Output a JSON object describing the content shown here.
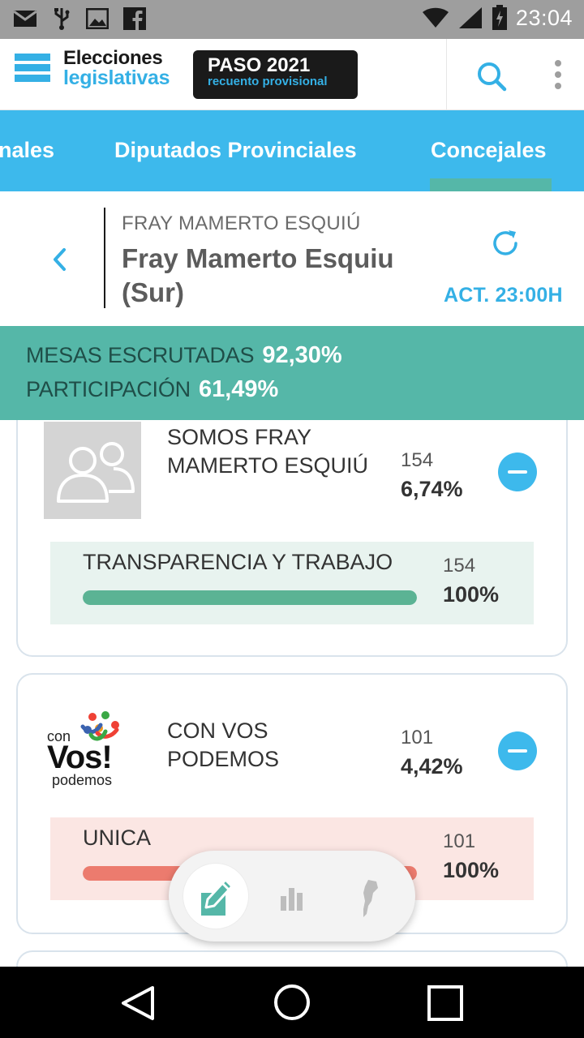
{
  "status_bar": {
    "time": "23:04",
    "left_icons": [
      "mail-icon",
      "usb-icon",
      "image-icon",
      "facebook-icon"
    ],
    "right_icons": [
      "wifi-icon",
      "signal-icon",
      "battery-icon"
    ]
  },
  "header": {
    "logo_line1": "Elecciones",
    "logo_line2": "legislativas",
    "badge_title": "PASO 2021",
    "badge_subtitle": "recuento provisional",
    "brand_color": "#34b0e5"
  },
  "tabs": [
    {
      "label": "nales",
      "active": false
    },
    {
      "label": "Diputados Provinciales",
      "active": false
    },
    {
      "label": "Concejales",
      "active": true
    }
  ],
  "location": {
    "region": "FRAY MAMERTO ESQUIÚ",
    "title": "Fray Mamerto Esquiu (Sur)",
    "updated": "ACT. 23:00H"
  },
  "stats": {
    "mesas_label": "MESAS ESCRUTADAS",
    "mesas_value": "92,30%",
    "participacion_label": "PARTICIPACIÓN",
    "participacion_value": "61,49%"
  },
  "parties": [
    {
      "name": "SOMOS FRAY MAMERTO ESQUIÚ",
      "votes": "154",
      "percent": "6,74%",
      "logo": "generic-users-icon",
      "lists": [
        {
          "name": "TRANSPARENCIA Y TRABAJO",
          "votes": "154",
          "percent": "100%",
          "fill": 1.0,
          "color": "#5bb394",
          "bg": "#e8f3ef"
        }
      ]
    },
    {
      "name": "CON VOS PODEMOS",
      "votes": "101",
      "percent": "4,42%",
      "logo_text": {
        "top": "con",
        "main": "Vos!",
        "bottom": "podemos"
      },
      "lists": [
        {
          "name": "UNICA",
          "votes": "101",
          "percent": "100%",
          "fill": 1.0,
          "color": "#ec7b6e",
          "bg": "#fbe6e3"
        }
      ]
    }
  ],
  "float_nav": [
    "vote-icon",
    "bar-chart-icon",
    "argentina-map-icon"
  ]
}
